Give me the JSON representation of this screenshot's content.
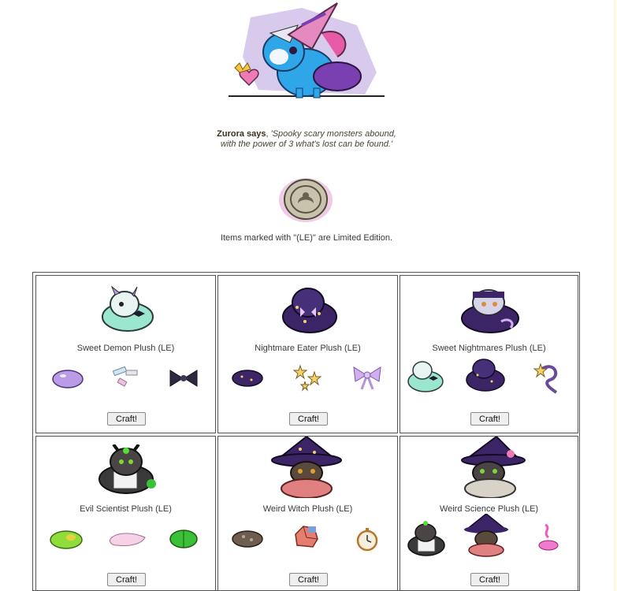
{
  "npc": {
    "speaker": "Zurora says",
    "quote_line1": "'Spooky scary monsters abound,",
    "quote_line2": "with the power of 3 what's lost can be found.'"
  },
  "note": "Items marked with \"(LE)\" are Limited Edition.",
  "recipes": [
    {
      "name": "Sweet Demon Plush (LE)",
      "button": "Craft!",
      "ingredients": [
        "purple-slime-icon",
        "candy-bits-icon",
        "dark-bow-icon"
      ]
    },
    {
      "name": "Nightmare Eater Plush (LE)",
      "button": "Craft!",
      "ingredients": [
        "starry-blob-icon",
        "sparkle-stars-icon",
        "lavender-bow-icon"
      ]
    },
    {
      "name": "Sweet Nightmares Plush (LE)",
      "button": "Craft!",
      "ingredients": [
        "sweet-demon-plush-icon",
        "nightmare-eater-plush-icon",
        "star-ribbon-icon"
      ]
    },
    {
      "name": "Evil Scientist Plush (LE)",
      "button": "Craft!",
      "ingredients": [
        "green-slime-icon",
        "pink-puddle-icon",
        "green-disc-icon"
      ]
    },
    {
      "name": "Weird Witch Plush (LE)",
      "button": "Craft!",
      "ingredients": [
        "brown-blob-icon",
        "patchwork-rock-icon",
        "pocket-watch-icon"
      ]
    },
    {
      "name": "Weird Science Plush (LE)",
      "button": "Craft!",
      "ingredients": [
        "evil-scientist-plush-icon",
        "weird-witch-plush-icon",
        "pink-potion-icon"
      ]
    }
  ],
  "colors": {
    "background": "#ffffff",
    "border": "#555555",
    "text": "#3a3a3a"
  }
}
